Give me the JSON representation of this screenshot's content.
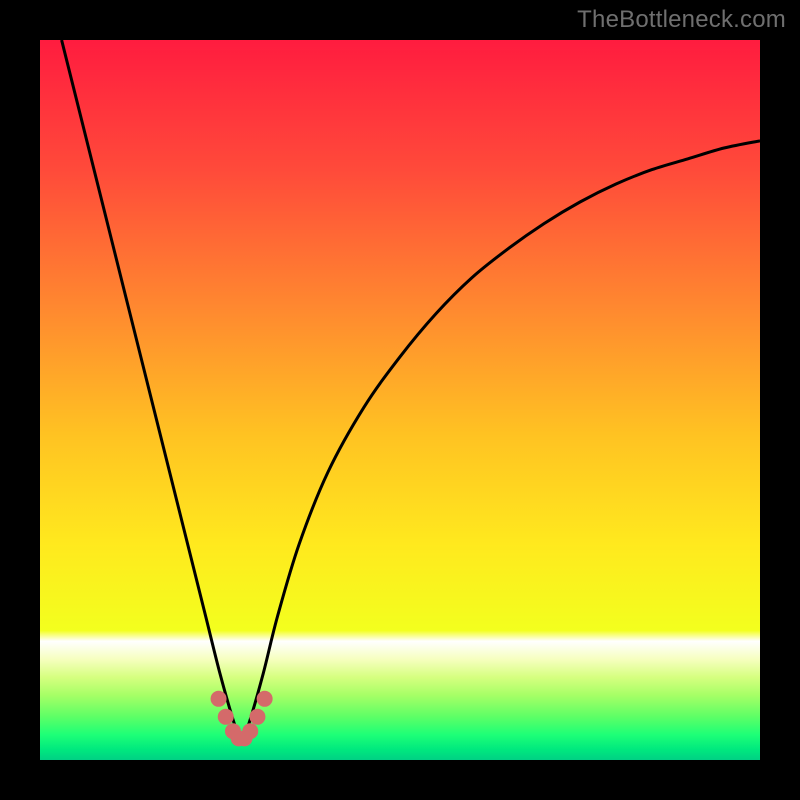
{
  "watermark": "TheBottleneck.com",
  "chart_data": {
    "type": "line",
    "title": "",
    "xlabel": "",
    "ylabel": "",
    "xlim": [
      0,
      100
    ],
    "ylim": [
      0,
      100
    ],
    "grid": false,
    "series": [
      {
        "name": "curve",
        "description": "V-shaped bottleneck curve with minimum around x≈28",
        "x": [
          3,
          6,
          9,
          12,
          15,
          18,
          21,
          23,
          25,
          27,
          28,
          29,
          31,
          33,
          36,
          40,
          45,
          50,
          55,
          60,
          65,
          70,
          75,
          80,
          85,
          90,
          95,
          100
        ],
        "y": [
          100,
          88,
          76,
          64,
          52,
          40,
          28,
          20,
          12,
          5,
          2.5,
          5,
          12,
          20,
          30,
          40,
          49,
          56,
          62,
          67,
          71,
          74.5,
          77.5,
          80,
          82,
          83.5,
          85,
          86
        ]
      }
    ],
    "markers": {
      "name": "highlight-points",
      "color": "#d46a6a",
      "x": [
        24.8,
        25.8,
        26.8,
        27.6,
        28.4,
        29.2,
        30.2,
        31.2
      ],
      "y": [
        8.5,
        6.0,
        4.0,
        3.0,
        3.0,
        4.0,
        6.0,
        8.5
      ],
      "radius": 8
    },
    "gradient_stops": [
      {
        "offset": 0.0,
        "color": "#ff1c3f"
      },
      {
        "offset": 0.18,
        "color": "#ff4a3a"
      },
      {
        "offset": 0.38,
        "color": "#ff8b2f"
      },
      {
        "offset": 0.55,
        "color": "#ffc322"
      },
      {
        "offset": 0.7,
        "color": "#ffe91e"
      },
      {
        "offset": 0.82,
        "color": "#f3ff1e"
      },
      {
        "offset": 0.835,
        "color": "#ffffff"
      },
      {
        "offset": 0.86,
        "color": "#f6ffbf"
      },
      {
        "offset": 0.885,
        "color": "#d6ff80"
      },
      {
        "offset": 0.91,
        "color": "#a6ff66"
      },
      {
        "offset": 0.94,
        "color": "#5dff66"
      },
      {
        "offset": 0.965,
        "color": "#1dff77"
      },
      {
        "offset": 0.985,
        "color": "#00e97e"
      },
      {
        "offset": 1.0,
        "color": "#00d084"
      }
    ]
  }
}
